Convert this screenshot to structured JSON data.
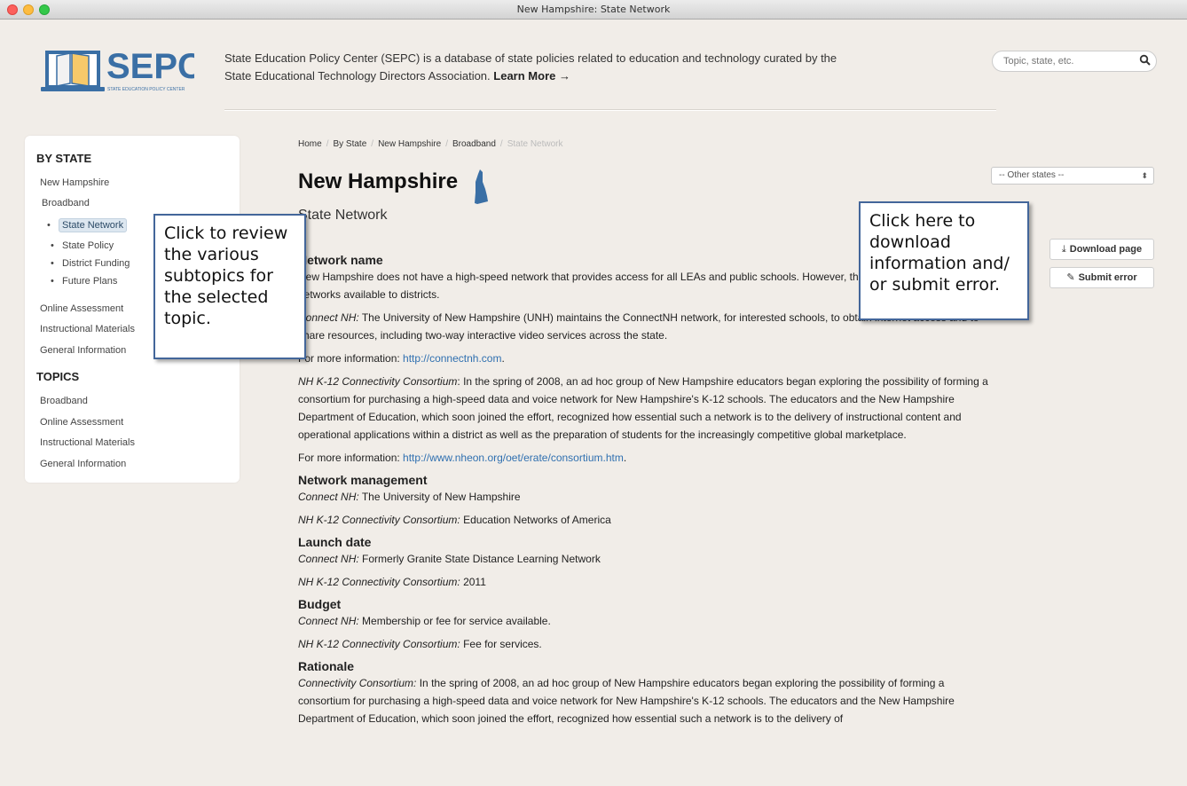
{
  "window": {
    "title": "New Hampshire: State Network"
  },
  "header": {
    "logo_text": "SEPC",
    "logo_subtext": "STATE EDUCATION POLICY CENTER",
    "intro_text": "State Education Policy Center (SEPC) is a database of state policies related to education and technology curated by the State Educational Technology Directors Association.",
    "learn_more": "Learn More →",
    "search_placeholder": "Topic, state, etc."
  },
  "sidebar": {
    "by_state_heading": "BY STATE",
    "state": "New Hampshire",
    "topic": "Broadband",
    "subtopics": [
      "State Network",
      "State Policy",
      "District Funding",
      "Future Plans"
    ],
    "other_state_topics": [
      "Online Assessment",
      "Instructional Materials",
      "General Information"
    ],
    "topics_heading": "TOPICS",
    "topics": [
      "Broadband",
      "Online Assessment",
      "Instructional Materials",
      "General Information"
    ]
  },
  "callouts": {
    "left": "Click to review the various subtopics for the selected topic.",
    "right": "Click here to download information and/ or submit error."
  },
  "breadcrumb": [
    "Home",
    "By State",
    "New Hampshire",
    "Broadband",
    "State Network"
  ],
  "main": {
    "title": "New Hampshire",
    "subtitle": "State Network",
    "states_select": "-- Other states --",
    "download_label": "Download page",
    "submit_label": "Submit error"
  },
  "sections": {
    "network_name": {
      "heading": "Network name",
      "p1": "New Hampshire does not have a high-speed network that provides access for all LEAs and public schools. However, there are two statewide networks available to districts.",
      "p2_label": "Connect NH:",
      "p2": " The University of New Hampshire (UNH) maintains the ConnectNH network, for interested schools, to obtain internet access and to share resources, including two-way interactive video services across the state.",
      "p3_prefix": "For more information: ",
      "p3_link": "http://connectnh.com",
      "p3_suffix": ".",
      "p4_label": "NH K-12 Connectivity Consortium",
      "p4": ": In the spring of 2008, an ad hoc group of New Hampshire educators began exploring the possibility of forming a consortium for purchasing a high-speed data and voice network for New Hampshire's K-12 schools. The educators and the New Hampshire Department of Education, which soon joined the effort, recognized how essential such a network is to the delivery of instructional content and operational applications within a district as well as the preparation of students for the increasingly competitive global marketplace.",
      "p5_prefix": "For more information: ",
      "p5_link": "http://www.nheon.org/oet/erate/consortium.htm",
      "p5_suffix": "."
    },
    "network_management": {
      "heading": "Network management",
      "l1_label": "Connect NH:",
      "l1": " The University of New Hampshire",
      "l2_label": "NH K-12 Connectivity Consortium:",
      "l2": " Education Networks of America"
    },
    "launch_date": {
      "heading": "Launch date",
      "l1_label": "Connect NH:",
      "l1": " Formerly Granite State Distance Learning Network",
      "l2_label": "NH K-12 Connectivity Consortium:",
      "l2": " 2011"
    },
    "budget": {
      "heading": "Budget",
      "l1_label": "Connect NH:",
      "l1": " Membership or fee for service available.",
      "l2_label": "NH K-12 Connectivity Consortium:",
      "l2": " Fee for services."
    },
    "rationale": {
      "heading": "Rationale",
      "l1_label": "Connectivity Consortium:",
      "l1": " In the spring of 2008, an ad hoc group of New Hampshire educators began exploring the possibility of forming a consortium for purchasing a high-speed data and voice network for New Hampshire's K-12 schools. The educators and the New Hampshire Department of Education, which soon joined the effort, recognized how essential such a network is to the delivery of"
    }
  },
  "colors": {
    "accent_blue": "#3a6fa5",
    "callout_border": "#43669a",
    "link": "#3070b0",
    "background": "#f1ede8"
  }
}
